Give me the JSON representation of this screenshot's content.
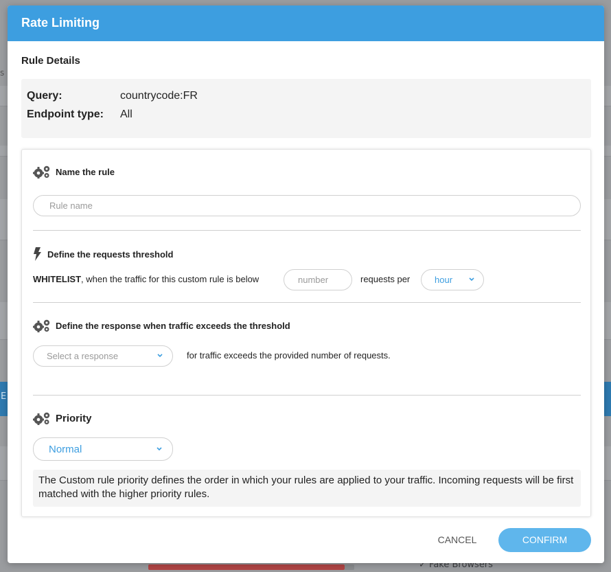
{
  "background": {
    "left_tab_fragment": "s",
    "left_blue_fragment": "E",
    "bottom_text": "Fake Browsers"
  },
  "modal": {
    "title": "Rate Limiting",
    "rule_details_title": "Rule Details",
    "details": [
      {
        "key": "Query:",
        "value": "countrycode:FR"
      },
      {
        "key": "Endpoint type:",
        "value": "All"
      }
    ],
    "name_section": {
      "title": "Name the rule",
      "icon": "gears-icon",
      "placeholder": "Rule name"
    },
    "threshold_section": {
      "title": "Define the requests threshold",
      "icon": "bolt-icon",
      "prefix_bold": "WHITELIST",
      "prefix_text": ", when the traffic for this custom rule is below",
      "number_placeholder": "number",
      "requests_per": "requests per",
      "period_value": "hour"
    },
    "response_section": {
      "title": "Define the response when traffic exceeds the threshold",
      "icon": "gears-icon",
      "select_placeholder": "Select a response",
      "suffix_text": "for traffic exceeds the provided number of requests."
    },
    "priority_section": {
      "title": "Priority",
      "icon": "gears-icon",
      "value": "Normal",
      "note": "The Custom rule priority defines the order in which your rules are applied to your traffic. Incoming requests will be first matched with the higher priority rules."
    },
    "buttons": {
      "cancel": "CANCEL",
      "confirm": "CONFIRM"
    },
    "colors": {
      "header": "#3d9ee0",
      "confirm": "#5fb6ec",
      "select_value": "#3d9ee0"
    }
  }
}
